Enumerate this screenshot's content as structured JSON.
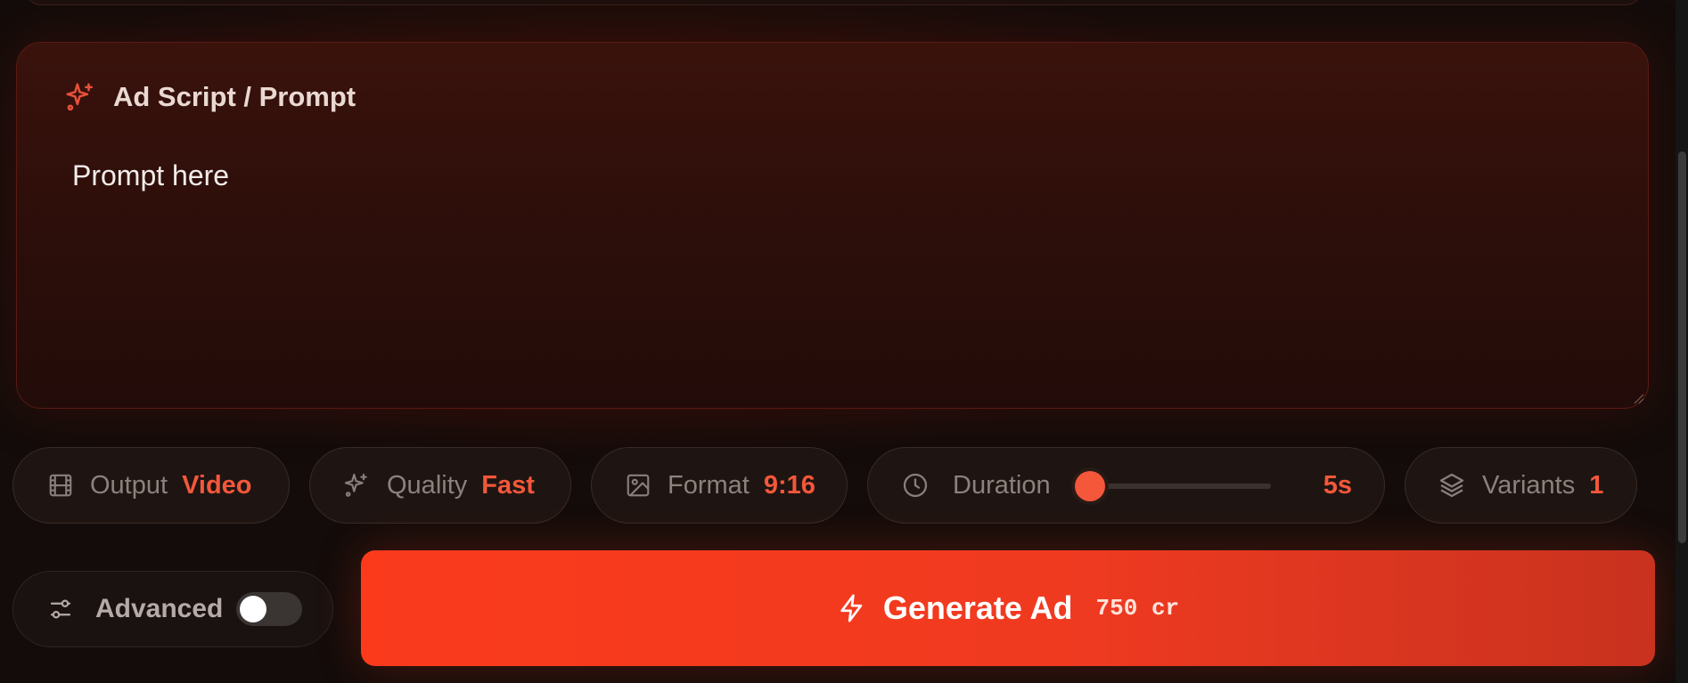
{
  "prompt_card": {
    "title": "Ad Script / Prompt",
    "icon": "sparkles-icon",
    "prompt_value": "Prompt here"
  },
  "options": {
    "output": {
      "label": "Output",
      "value": "Video",
      "icon": "film-icon"
    },
    "quality": {
      "label": "Quality",
      "value": "Fast",
      "icon": "sparkles-icon"
    },
    "format": {
      "label": "Format",
      "value": "9:16",
      "icon": "image-icon"
    },
    "duration": {
      "label": "Duration",
      "value": "5s",
      "icon": "clock-icon",
      "slider_level": 0
    },
    "variants": {
      "label": "Variants",
      "value": "1",
      "icon": "layers-icon"
    }
  },
  "advanced": {
    "label": "Advanced",
    "icon": "sliders-icon",
    "enabled": false
  },
  "generate": {
    "label": "Generate Ad",
    "cost": "750 cr",
    "icon": "bolt-icon"
  },
  "colors": {
    "accent": "#f4573a",
    "button_start": "#fb3a1c",
    "button_end": "#c8321f",
    "background": "#130c0a"
  }
}
